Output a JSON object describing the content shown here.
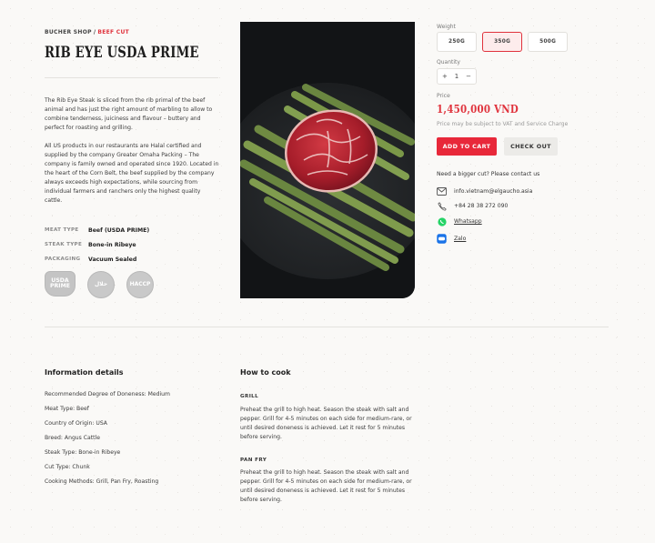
{
  "breadcrumb": {
    "shop": "BUCHER SHOP",
    "separator": "/",
    "current": "BEEF CUT"
  },
  "product": {
    "title": "RIB EYE USDA PRIME",
    "description_1": "The Rib Eye Steak is sliced from the rib primal of the beef animal and has just the right amount of marbling to allow to combine tenderness, juiciness and flavour – buttery and perfect for roasting and grilling.",
    "description_2": "All US products in our restaurants are Halal certified and supplied by the company Greater Omaha Packing – The company is family owned and operated since 1920. Located in the heart of the Corn Belt, the beef supplied by the company always exceeds high expectations, while sourcing from individual farmers and ranchers only the highest quality cattle.",
    "specs": [
      {
        "key": "MEAT TYPE",
        "value": "Beef (USDA PRIME)"
      },
      {
        "key": "STEAK TYPE",
        "value": "Bone-in Ribeye"
      },
      {
        "key": "PACKAGING",
        "value": "Vacuum Sealed"
      }
    ],
    "badges": [
      "USDA PRIME",
      "حلال",
      "HACCP"
    ]
  },
  "purchase": {
    "weight_label": "Weight",
    "weights": [
      "250G",
      "350G",
      "500G"
    ],
    "selected_weight": "350G",
    "quantity_label": "Quantity",
    "quantity": "1",
    "price_label": "Price",
    "price": "1,450,000 VND",
    "vat_note": "Price may be subject to VAT and Service Charge",
    "add_to_cart": "ADD TO CART",
    "check_out": "CHECK OUT",
    "bigger_cut": "Need a bigger cut? Please contact us",
    "contacts": {
      "email": "info.vietnam@elgaucho.asia",
      "phone": "+84 28 38 272 090",
      "whatsapp": "Whatsapp",
      "zalo": "Zalo"
    }
  },
  "info": {
    "heading": "Information details",
    "items": [
      "Recommended Degree of Doneness: Medium",
      "Meat Type: Beef",
      "Country of Origin: USA",
      "Breed: Angus Cattle",
      "Steak Type: Bone-in Ribeye",
      "Cut Type: Chunk",
      "Cooking Methods: Grill, Pan Fry, Roasting"
    ]
  },
  "cook": {
    "heading": "How to cook",
    "grill_title": "GRILL",
    "grill_text": "Preheat the grill to high heat. Season the steak with salt and pepper. Grill for 4-5 minutes on each side for medium-rare, or until desired doneness is achieved. Let it rest for 5 minutes before serving.",
    "panfry_title": "PAN FRY",
    "panfry_text": "Preheat the grill to high heat. Season the steak with salt and pepper. Grill for 4-5 minutes on each side for medium-rare, or until desired doneness is achieved. Let it rest for 5 minutes before serving."
  },
  "colors": {
    "accent": "#e0323c",
    "button_primary": "#e8283a",
    "button_secondary": "#ecebe8"
  }
}
